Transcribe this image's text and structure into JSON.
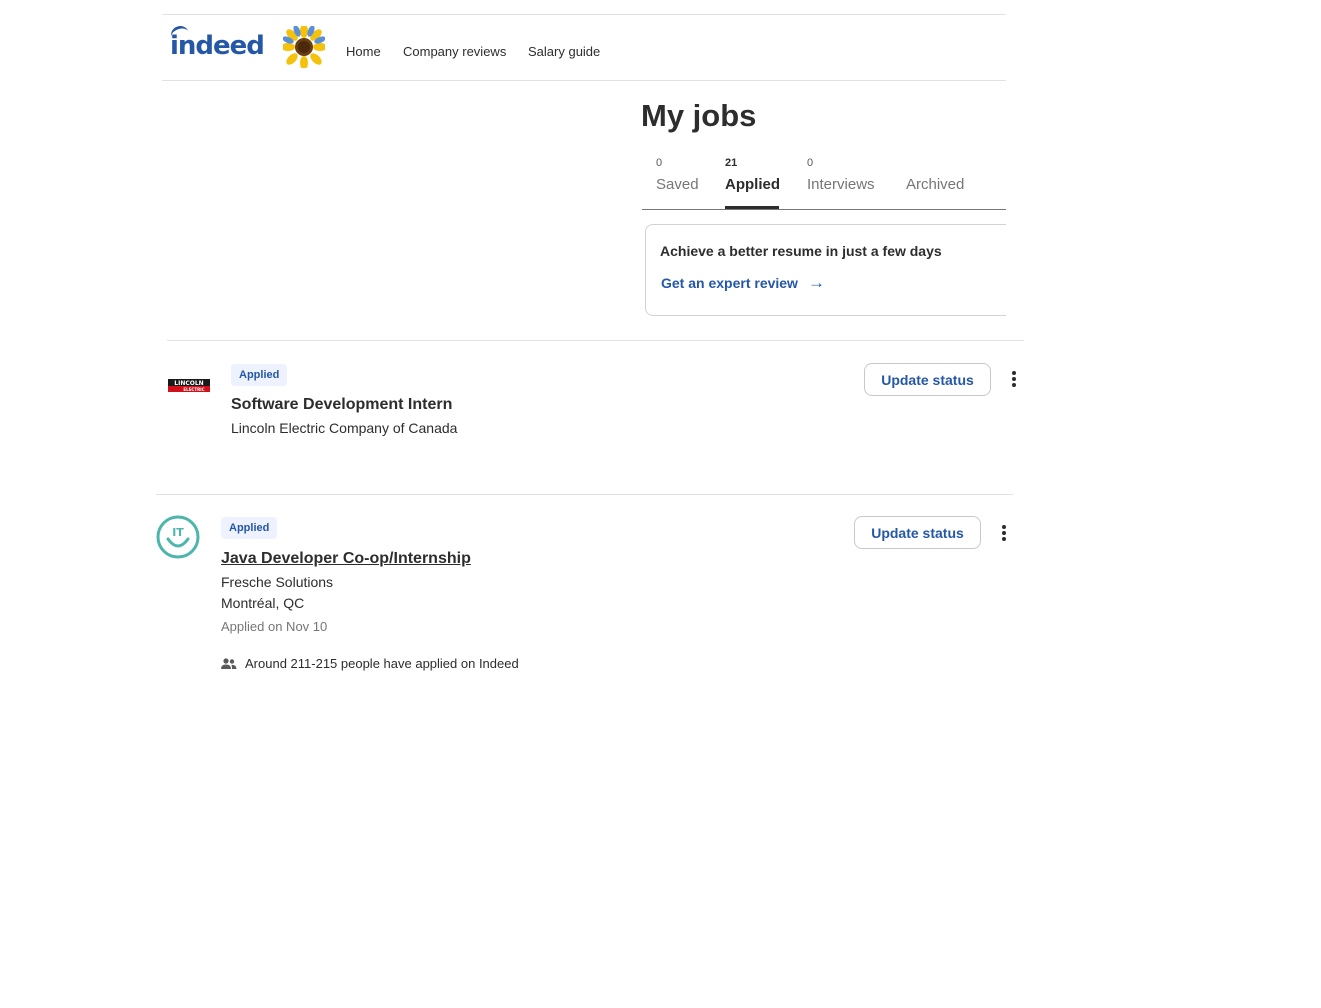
{
  "header": {
    "logo_text": "indeed",
    "nav": [
      {
        "label": "Home"
      },
      {
        "label": "Company reviews"
      },
      {
        "label": "Salary guide"
      }
    ]
  },
  "page": {
    "title": "My jobs",
    "tabs": [
      {
        "count": "0",
        "label": "Saved",
        "active": false
      },
      {
        "count": "21",
        "label": "Applied",
        "active": true
      },
      {
        "count": "0",
        "label": "Interviews",
        "active": false
      },
      {
        "count": "",
        "label": "Archived",
        "active": false
      }
    ]
  },
  "promo": {
    "title": "Achieve a better resume in just a few days",
    "link_label": "Get an expert review",
    "arrow": "→"
  },
  "jobs": [
    {
      "badge": "Applied",
      "title": "Software Development Intern",
      "company": "Lincoln Electric Company of Canada",
      "logo_text": "LINCOLN ELECTRIC",
      "update_label": "Update status"
    },
    {
      "badge": "Applied",
      "title": "Java Developer Co-op/Internship",
      "company": "Fresche Solutions",
      "location": "Montréal, QC",
      "applied_on": "Applied on Nov 10",
      "applicants": "Around 211-215 people have applied on Indeed",
      "logo_text": "IT",
      "update_label": "Update status"
    }
  ],
  "colors": {
    "brand_blue": "#2557a7",
    "badge_bg": "#eef1fe",
    "text": "#2d2d2d",
    "muted": "#767676",
    "teal": "#4db6ac",
    "lincoln_red": "#d0101b"
  }
}
